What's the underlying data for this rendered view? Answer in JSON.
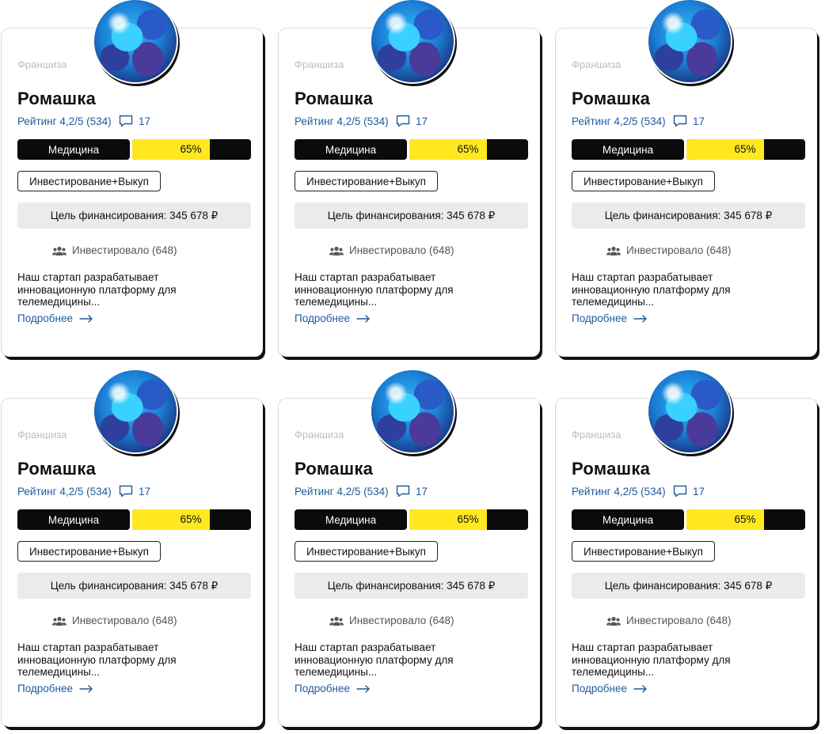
{
  "cards": [
    {
      "category": "Франшиза",
      "title": "Ромашка",
      "rating": "Рейтинг 4,2/5 (534)",
      "comments": "17",
      "sector": "Медицина",
      "progress_value": 0.65,
      "progress_label": "65%",
      "deal_type": "Инвестирование+Выкуп",
      "goal": "Цель финансирования: 345 678 ₽",
      "investors": "Инвестировало (648)",
      "description": "Наш стартап разрабатывает инновационную платформу для телемедицины...",
      "more": "Подробнее"
    },
    {
      "category": "Франшиза",
      "title": "Ромашка",
      "rating": "Рейтинг 4,2/5 (534)",
      "comments": "17",
      "sector": "Медицина",
      "progress_value": 0.65,
      "progress_label": "65%",
      "deal_type": "Инвестирование+Выкуп",
      "goal": "Цель финансирования: 345 678 ₽",
      "investors": "Инвестировало (648)",
      "description": "Наш стартап разрабатывает инновационную платформу для телемедицины...",
      "more": "Подробнее"
    },
    {
      "category": "Франшиза",
      "title": "Ромашка",
      "rating": "Рейтинг 4,2/5 (534)",
      "comments": "17",
      "sector": "Медицина",
      "progress_value": 0.65,
      "progress_label": "65%",
      "deal_type": "Инвестирование+Выкуп",
      "goal": "Цель финансирования: 345 678 ₽",
      "investors": "Инвестировало (648)",
      "description": "Наш стартап разрабатывает инновационную платформу для телемедицины...",
      "more": "Подробнее"
    },
    {
      "category": "Франшиза",
      "title": "Ромашка",
      "rating": "Рейтинг 4,2/5 (534)",
      "comments": "17",
      "sector": "Медицина",
      "progress_value": 0.65,
      "progress_label": "65%",
      "deal_type": "Инвестирование+Выкуп",
      "goal": "Цель финансирования: 345 678 ₽",
      "investors": "Инвестировало (648)",
      "description": "Наш стартап разрабатывает инновационную платформу для телемедицины...",
      "more": "Подробнее"
    },
    {
      "category": "Франшиза",
      "title": "Ромашка",
      "rating": "Рейтинг 4,2/5 (534)",
      "comments": "17",
      "sector": "Медицина",
      "progress_value": 0.65,
      "progress_label": "65%",
      "deal_type": "Инвестирование+Выкуп",
      "goal": "Цель финансирования: 345 678 ₽",
      "investors": "Инвестировало (648)",
      "description": "Наш стартап разрабатывает инновационную платформу для телемедицины...",
      "more": "Подробнее"
    },
    {
      "category": "Франшиза",
      "title": "Ромашка",
      "rating": "Рейтинг 4,2/5 (534)",
      "comments": "17",
      "sector": "Медицина",
      "progress_value": 0.65,
      "progress_label": "65%",
      "deal_type": "Инвестирование+Выкуп",
      "goal": "Цель финансирования: 345 678 ₽",
      "investors": "Инвестировало (648)",
      "description": "Наш стартап разрабатывает инновационную платформу для телемедицины...",
      "more": "Подробнее"
    }
  ],
  "colors": {
    "accent_link": "#1f5a9c",
    "progress_fill": "#ffe81f",
    "progress_track": "#0b0b0b",
    "sector_bg": "#0b0b0b",
    "goal_bg": "#ebebeb"
  },
  "icons": {
    "avatar": "planet-image",
    "comments": "chat-bubble-icon",
    "investors": "people-icon",
    "more": "arrow-right-icon"
  }
}
